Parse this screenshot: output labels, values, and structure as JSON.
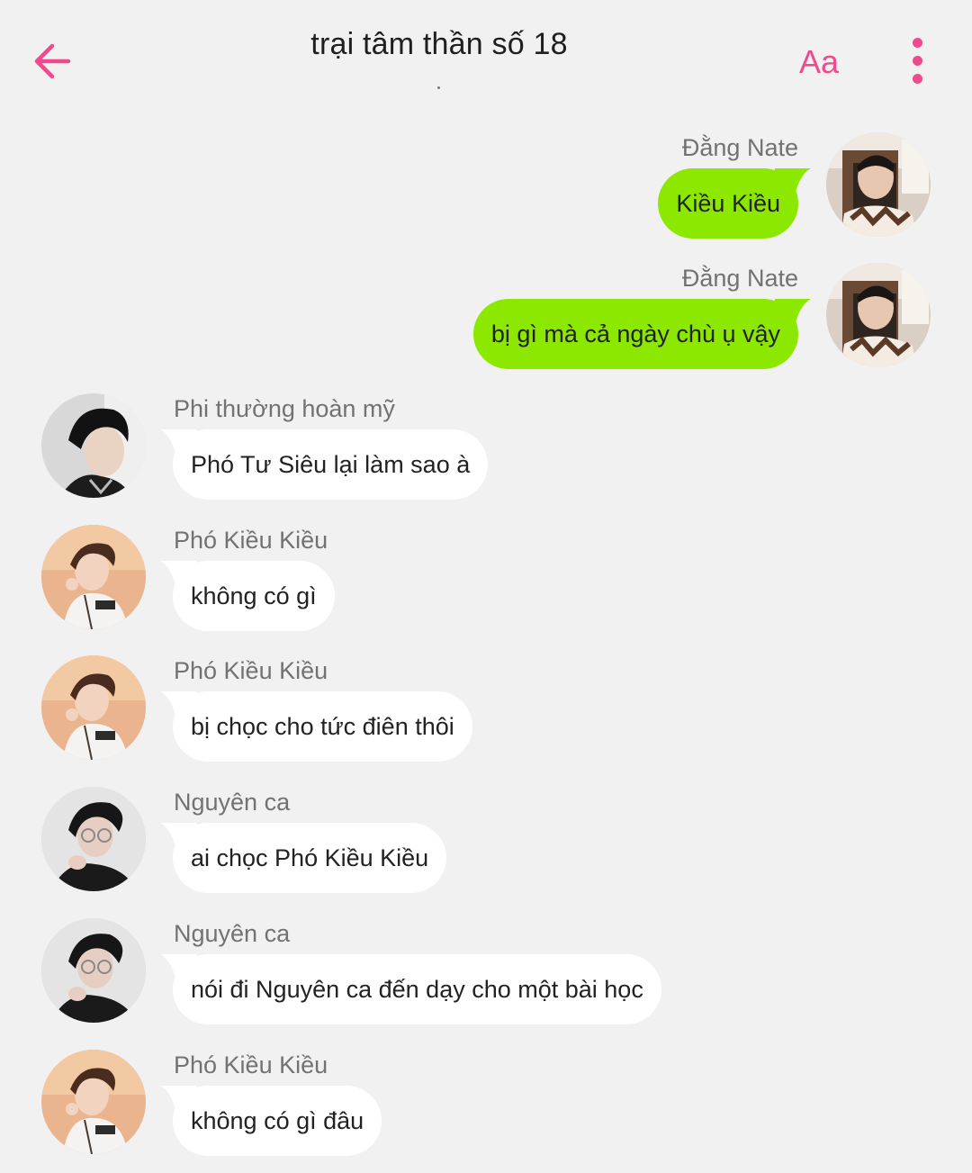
{
  "header": {
    "title": "trại tâm thần số 18",
    "font_button_label": "Aa",
    "accent_color": "#ee4a8c"
  },
  "messages": [
    {
      "direction": "outgoing",
      "sender": "Đằng Nate",
      "text": "Kiều Kiều",
      "avatar": "avatar-dang-nate"
    },
    {
      "direction": "outgoing",
      "sender": "Đằng Nate",
      "text": "bị gì mà cả ngày chù ụ vậy",
      "avatar": "avatar-dang-nate"
    },
    {
      "direction": "incoming",
      "sender": "Phi thường hoàn mỹ",
      "text": "Phó Tư Siêu lại làm sao à",
      "avatar": "avatar-phi-thuong-hoan-my"
    },
    {
      "direction": "incoming",
      "sender": "Phó Kiều Kiều",
      "text": "không có gì",
      "avatar": "avatar-pho-kieu-kieu"
    },
    {
      "direction": "incoming",
      "sender": "Phó Kiều Kiều",
      "text": "bị chọc cho tức điên thôi",
      "avatar": "avatar-pho-kieu-kieu"
    },
    {
      "direction": "incoming",
      "sender": "Nguyên ca",
      "text": "ai chọc Phó Kiều Kiều",
      "avatar": "avatar-nguyen-ca"
    },
    {
      "direction": "incoming",
      "sender": "Nguyên ca",
      "text": "nói đi Nguyên ca đến dạy cho một bài học",
      "avatar": "avatar-nguyen-ca"
    },
    {
      "direction": "incoming",
      "sender": "Phó Kiều Kiều",
      "text": "không có gì đâu",
      "avatar": "avatar-pho-kieu-kieu"
    }
  ],
  "colors": {
    "outgoing_bubble": "#8de800",
    "incoming_bubble": "#ffffff",
    "background": "#f1f1f1",
    "sender_name": "#727272"
  }
}
